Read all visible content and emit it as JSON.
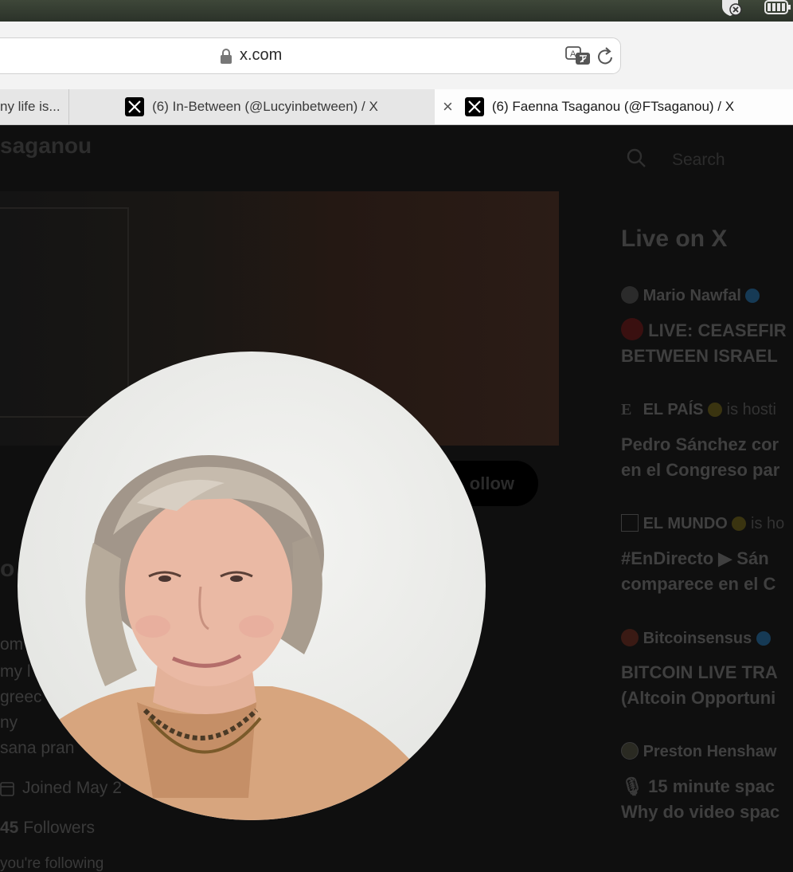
{
  "browser": {
    "url": "x.com",
    "tabs": [
      {
        "label": "ny life is..."
      },
      {
        "label": "(6) In-Between (@Lucyinbetween) / X"
      },
      {
        "label": "(6) Faenna Tsaganou (@FTsaganou) / X",
        "active": true
      }
    ]
  },
  "profile": {
    "header_name": "saganou",
    "follow_label": "ollow",
    "name_fragment": "o",
    "bio_lines": [
      "om",
      "my l",
      "greec",
      "ny",
      "sana pran"
    ],
    "joined": "Joined May 2",
    "followers_count": "45",
    "followers_label": "Followers",
    "following_note": "you're following"
  },
  "sidebar": {
    "search_placeholder": "Search",
    "live_title": "Live on X",
    "live_items": [
      {
        "host": "Mario Nawfal",
        "host_suffix": "",
        "headline": [
          "LIVE: CEASEFIR",
          "BETWEEN ISRAEL"
        ]
      },
      {
        "host": "EL PAÍS",
        "host_suffix": "is hosti",
        "headline": [
          "Pedro Sánchez cor",
          "en el Congreso par"
        ]
      },
      {
        "host": "EL MUNDO",
        "host_suffix": "is ho",
        "headline": [
          "#EnDirecto ▶ Sán",
          "comparece en el C"
        ]
      },
      {
        "host": "Bitcoinsensus",
        "host_suffix": "",
        "headline": [
          "BITCOIN LIVE TRA",
          "(Altcoin Opportuni"
        ]
      },
      {
        "host": "Preston Henshaw",
        "host_suffix": "",
        "headline": [
          "15 minute spac",
          "Why do video spac"
        ]
      }
    ]
  },
  "colors": {
    "overlay_bg": "#0f0f0f",
    "verified": "#1d9bf0",
    "tab_active": "#fdfdfd"
  }
}
